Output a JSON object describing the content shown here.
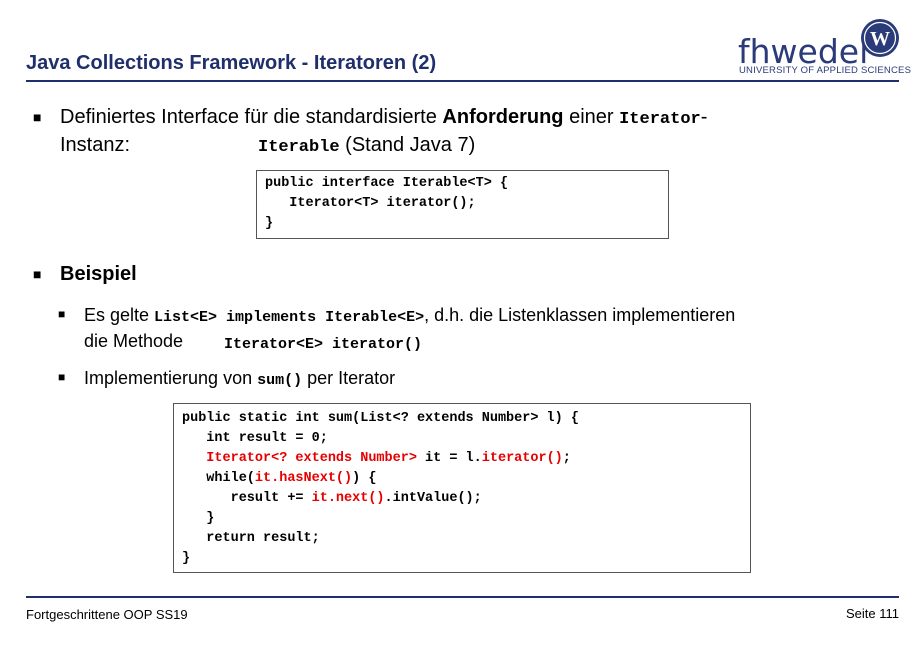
{
  "header": {
    "title": "Java Collections Framework - Iteratoren (2)",
    "logo_text": "fhwedel",
    "logo_sub": "UNIVERSITY OF APPLIED SCIENCES",
    "badge_letter": "W"
  },
  "bullet1": {
    "line1_a": "Definiertes Interface für die standardisierte ",
    "line1_bold": "Anforderung",
    "line1_b": " einer ",
    "line1_code": "Iterator",
    "line1_dash": "-",
    "line2_a": "Instanz:",
    "line2_code": "Iterable",
    "line2_b": " (Stand Java 7)"
  },
  "code1": {
    "lines": [
      "public interface Iterable<T> {",
      "   Iterator<T> iterator();",
      "}"
    ]
  },
  "bullet2": {
    "label": "Beispiel"
  },
  "sub1": {
    "a": "Es gelte ",
    "code": "List<E> implements Iterable<E>",
    "b": ", d.h. die Listenklassen implementieren",
    "line2_a": "die Methode",
    "line2_code": "Iterator<E> iterator()"
  },
  "sub2": {
    "a": "Implementierung von ",
    "code": "sum()",
    "b": " per Iterator"
  },
  "code2": {
    "l1": "public static int sum(List<? extends Number> l) {",
    "l2": "   int result = 0;",
    "l3_red1": "   Iterator<? extends Number>",
    "l3_mid": " it = l.",
    "l3_red2": "iterator()",
    "l3_end": ";",
    "l4_a": "   while(",
    "l4_red": "it.hasNext()",
    "l4_b": ") {",
    "l5_a": "      result += ",
    "l5_red": "it.next()",
    "l5_b": ".intValue();",
    "l6": "   }",
    "l7": "   return result;",
    "l8": "}"
  },
  "footer": {
    "left": "Fortgeschrittene OOP SS19",
    "right": "Seite 111"
  },
  "colors": {
    "accent": "#1f2f6b",
    "highlight": "#e60000"
  }
}
